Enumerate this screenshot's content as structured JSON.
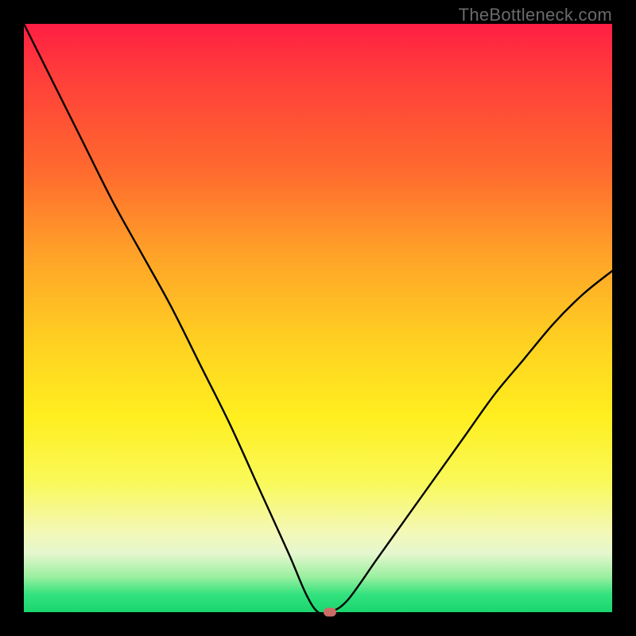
{
  "attribution": "TheBottleneck.com",
  "chart_data": {
    "type": "line",
    "title": "",
    "xlabel": "",
    "ylabel": "",
    "xlim": [
      0,
      100
    ],
    "ylim": [
      0,
      100
    ],
    "grid": false,
    "legend": false,
    "series": [
      {
        "name": "bottleneck-curve",
        "x": [
          0,
          5,
          10,
          15,
          20,
          25,
          30,
          35,
          40,
          45,
          48,
          50,
          52,
          55,
          60,
          65,
          70,
          75,
          80,
          85,
          90,
          95,
          100
        ],
        "y": [
          100,
          90,
          80,
          70,
          61,
          52,
          42,
          32,
          21,
          10,
          3,
          0,
          0,
          2,
          9,
          16,
          23,
          30,
          37,
          43,
          49,
          54,
          58
        ]
      }
    ],
    "marker": {
      "x": 52,
      "y": 0
    },
    "background_gradient": {
      "stops": [
        {
          "pos": 0.0,
          "color": "#ff1e44"
        },
        {
          "pos": 0.08,
          "color": "#ff3b3b"
        },
        {
          "pos": 0.25,
          "color": "#ff6a2e"
        },
        {
          "pos": 0.4,
          "color": "#ffa528"
        },
        {
          "pos": 0.55,
          "color": "#ffd321"
        },
        {
          "pos": 0.67,
          "color": "#ffef20"
        },
        {
          "pos": 0.78,
          "color": "#f9f95a"
        },
        {
          "pos": 0.86,
          "color": "#f4f8b3"
        },
        {
          "pos": 0.9,
          "color": "#e6f7cf"
        },
        {
          "pos": 0.94,
          "color": "#9aef9f"
        },
        {
          "pos": 0.97,
          "color": "#33e27e"
        },
        {
          "pos": 1.0,
          "color": "#19d66e"
        }
      ]
    }
  }
}
